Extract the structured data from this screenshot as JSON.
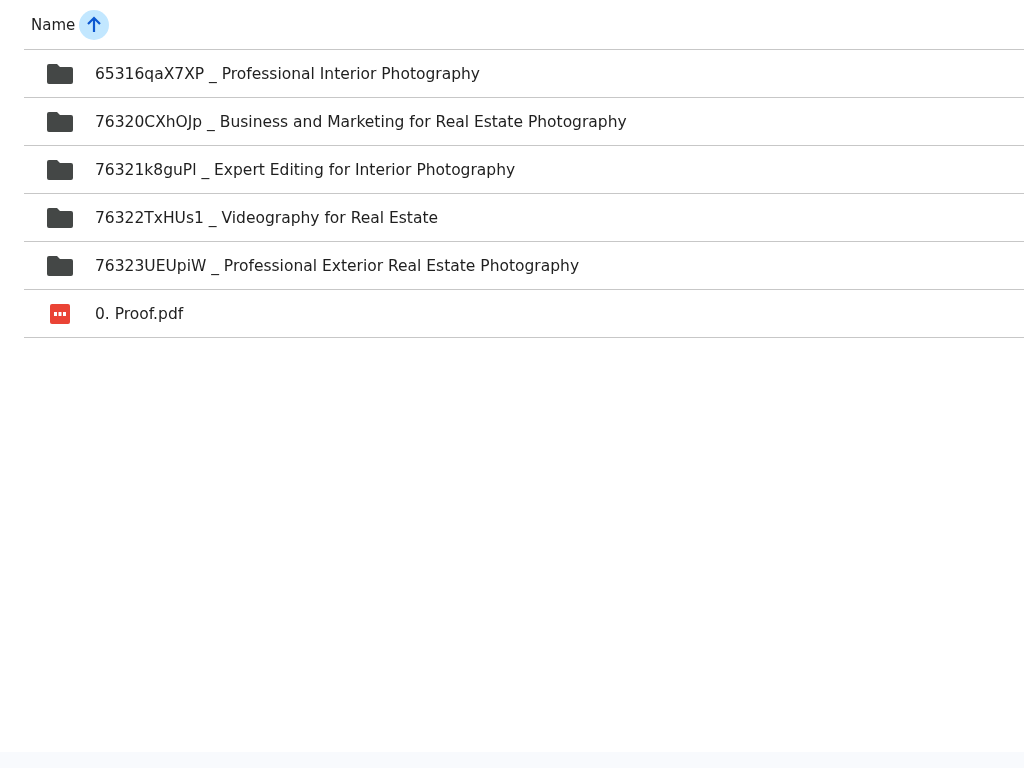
{
  "header": {
    "label": "Name",
    "sort_ascending": true
  },
  "files": [
    {
      "kind": "folder",
      "name": "65316qaX7XP _ Professional Interior Photography"
    },
    {
      "kind": "folder",
      "name": "76320CXhOJp _ Business and Marketing for Real Estate Photography"
    },
    {
      "kind": "folder",
      "name": "76321k8guPl _ Expert Editing for Interior Photography"
    },
    {
      "kind": "folder",
      "name": "76322TxHUs1 _ Videography for Real Estate"
    },
    {
      "kind": "folder",
      "name": "76323UEUpiW _ Professional Exterior Real Estate Photography"
    },
    {
      "kind": "pdf",
      "name": "0. Proof.pdf"
    }
  ]
}
